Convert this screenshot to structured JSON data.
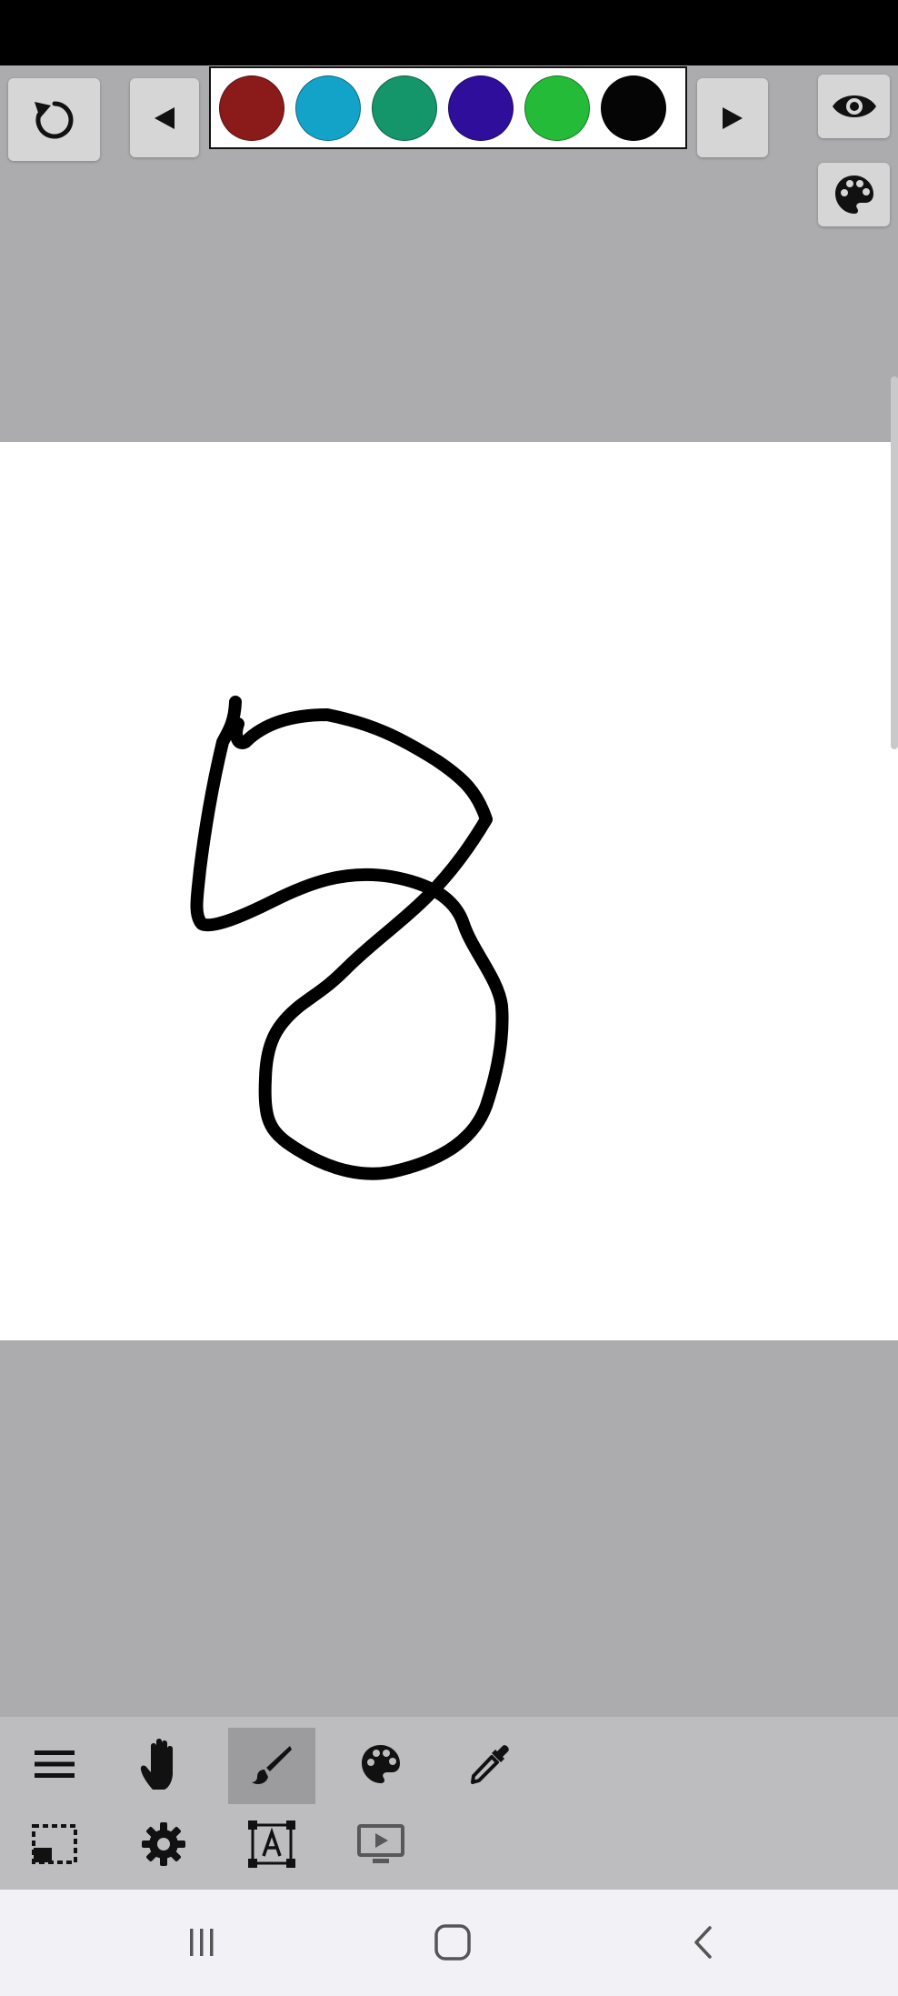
{
  "palette": {
    "colors": [
      "#8b1a1a",
      "#13a3c9",
      "#14956a",
      "#2e0e9a",
      "#24bb38",
      "#050505"
    ]
  },
  "icons": {
    "undo": "undo-icon",
    "prev": "triangle-left-icon",
    "next": "triangle-right-icon",
    "visibility": "eye-icon",
    "palette": "palette-icon",
    "menu": "hamburger-icon",
    "pan": "hand-icon",
    "brush": "brush-icon",
    "color": "palette-icon",
    "picker": "eyedropper-icon",
    "selection": "selection-icon",
    "settings": "gear-icon",
    "text": "text-frame-icon",
    "present": "play-screen-icon"
  },
  "toolbar": {
    "active_tool": "brush"
  },
  "theme": {
    "workspace": "#acabad",
    "canvas": "#ffffff",
    "toolbar": "#bdbcbf",
    "active_tool": "#9c9b9e",
    "stroke": "#000000"
  }
}
